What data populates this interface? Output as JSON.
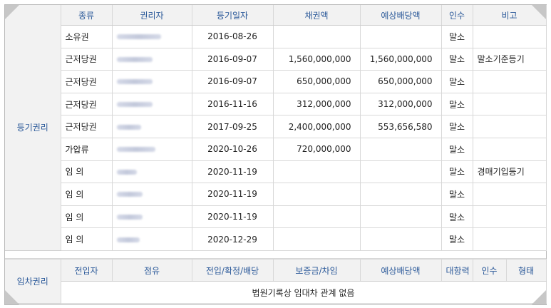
{
  "registry": {
    "section_label": "등기권리",
    "headers": {
      "type": "종류",
      "holder": "권리자",
      "date": "등기일자",
      "amount": "채권액",
      "dividend": "예상배당액",
      "takeover": "인수",
      "note": "비고"
    },
    "rows": [
      {
        "type": "소유권",
        "date": "2016-08-26",
        "amount": "",
        "dividend": "",
        "takeover": "말소",
        "note": ""
      },
      {
        "type": "근저당권",
        "date": "2016-09-07",
        "amount": "1,560,000,000",
        "dividend": "1,560,000,000",
        "takeover": "말소",
        "note": "말소기준등기"
      },
      {
        "type": "근저당권",
        "date": "2016-09-07",
        "amount": "650,000,000",
        "dividend": "650,000,000",
        "takeover": "말소",
        "note": ""
      },
      {
        "type": "근저당권",
        "date": "2016-11-16",
        "amount": "312,000,000",
        "dividend": "312,000,000",
        "takeover": "말소",
        "note": ""
      },
      {
        "type": "근저당권",
        "date": "2017-09-25",
        "amount": "2,400,000,000",
        "dividend": "553,656,580",
        "takeover": "말소",
        "note": ""
      },
      {
        "type": "가압류",
        "date": "2020-10-26",
        "amount": "720,000,000",
        "dividend": "",
        "takeover": "말소",
        "note": ""
      },
      {
        "type": "임 의",
        "date": "2020-11-19",
        "amount": "",
        "dividend": "",
        "takeover": "말소",
        "note": "경매기입등기"
      },
      {
        "type": "임 의",
        "date": "2020-11-19",
        "amount": "",
        "dividend": "",
        "takeover": "말소",
        "note": ""
      },
      {
        "type": "임 의",
        "date": "2020-11-19",
        "amount": "",
        "dividend": "",
        "takeover": "말소",
        "note": ""
      },
      {
        "type": "임 의",
        "date": "2020-12-29",
        "amount": "",
        "dividend": "",
        "takeover": "말소",
        "note": ""
      }
    ]
  },
  "lease": {
    "section_label": "임차권리",
    "headers": {
      "tenant": "전입자",
      "occupancy": "점유",
      "move_in": "전입/확정/배당",
      "deposit": "보증금/차임",
      "dividend": "예상배당액",
      "priority": "대항력",
      "takeover": "인수",
      "form": "형태"
    },
    "empty_message": "법원기록상 임대차 관계 없음"
  }
}
